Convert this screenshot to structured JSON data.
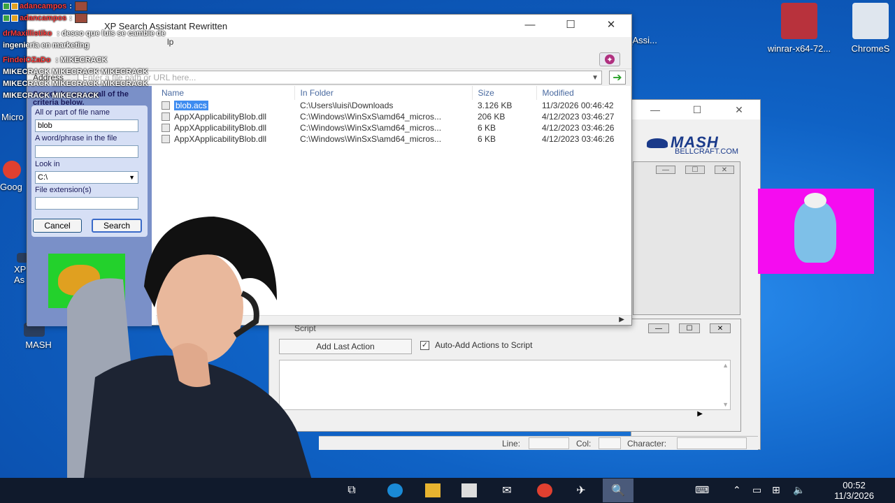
{
  "desktop": {
    "icons": [
      {
        "label": "winrar-x64-72...",
        "color": "#b8323c"
      },
      {
        "label": "ChromeS",
        "color": "#dfe6ee"
      },
      {
        "label": "MASH",
        "color": "#2a3e5e"
      },
      {
        "label": "h_Assi...",
        "color": "#1573d4"
      }
    ],
    "partial_labels": [
      "Micro",
      "Goog",
      "XP",
      "As"
    ]
  },
  "chat": {
    "messages": [
      {
        "user": "adancampos",
        "text": ":"
      },
      {
        "user": "adancampos",
        "text": ":"
      },
      {
        "user": "drMaxillistiko",
        "text": ": deseo que luis se cambie de ingeniería en marketing"
      },
      {
        "user": "FindeiOZaDo",
        "text": ": MIKECRACK MIKECRACK MIKECRACK MIKECRACK MIKECRACK MIKECRACK MIKECRACK MIKECRACK MIKECRACK"
      }
    ]
  },
  "search_window": {
    "title": "XP Search Assistant Rewritten",
    "menu_partial": "lp",
    "address_label": "Address",
    "address_placeholder": "Enter a file path or URL here...",
    "left_panel": {
      "header": "Search by any or all of the criteria below.",
      "label_name": "All or part of file name",
      "value_name": "blob",
      "label_phrase": "A word/phrase in the file",
      "value_phrase": "",
      "label_lookin": "Look in",
      "value_lookin": "C:\\",
      "label_ext": "File extension(s)",
      "value_ext": "",
      "cancel_label": "Cancel",
      "search_label": "Search"
    },
    "columns": [
      "Name",
      "In Folder",
      "Size",
      "Modified"
    ],
    "rows": [
      {
        "name": "blob.acs",
        "folder": "C:\\Users\\luisi\\Downloads",
        "size": "3.126 KB",
        "modified": "11/3/2026 00:46:42",
        "selected": true
      },
      {
        "name": "AppXApplicabilityBlob.dll",
        "folder": "C:\\Windows\\WinSxS\\amd64_micros...",
        "size": "206 KB",
        "modified": "4/12/2023 03:46:27",
        "selected": false
      },
      {
        "name": "AppXApplicabilityBlob.dll",
        "folder": "C:\\Windows\\WinSxS\\amd64_micros...",
        "size": "6 KB",
        "modified": "4/12/2023 03:46:26",
        "selected": false
      },
      {
        "name": "AppXApplicabilityBlob.dll",
        "folder": "C:\\Windows\\WinSxS\\amd64_micros...",
        "size": "6 KB",
        "modified": "4/12/2023 03:46:26",
        "selected": false
      }
    ]
  },
  "mash": {
    "logo": "MASH",
    "subtitle": "BELLCRAFT.COM",
    "script_title": "Script",
    "add_last_action": "Add Last Action",
    "auto_add": "Auto-Add Actions to Script",
    "auto_add_checked": "✓",
    "status_line": "Line:",
    "status_col": "Col:",
    "status_char": "Character:"
  },
  "taskbar": {
    "time": "00:52",
    "date": "11/3/2026"
  }
}
